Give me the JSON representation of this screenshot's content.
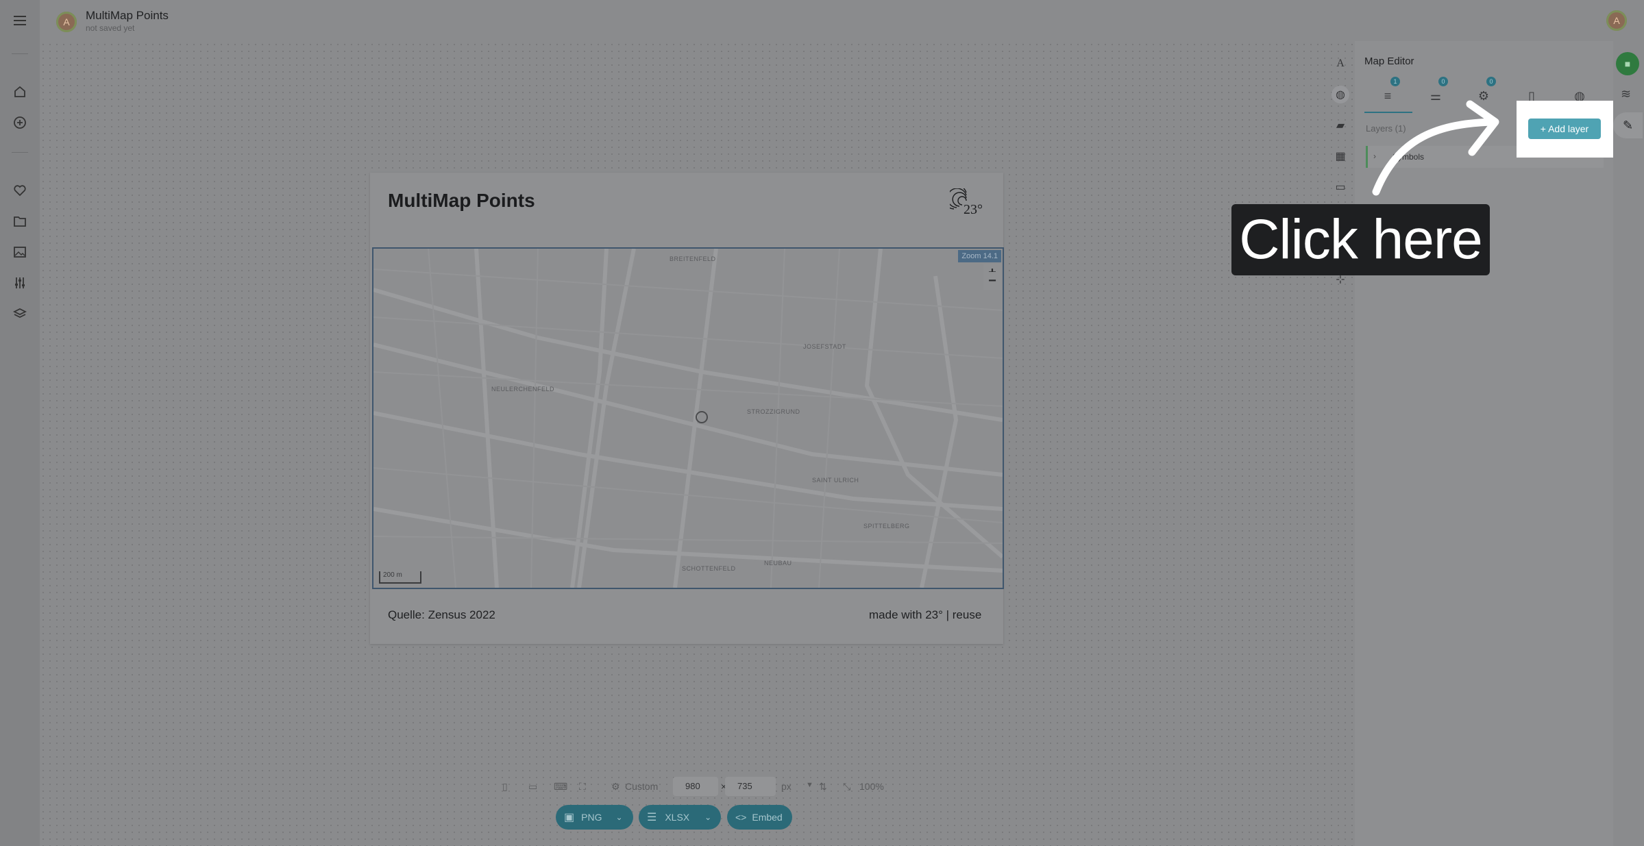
{
  "app": {
    "title": "MultiMap Points",
    "subtitle": "not saved yet",
    "avatar_initial": "A"
  },
  "left_nav": {
    "items": [
      "menu-icon",
      "home-icon",
      "add-icon",
      "heart-icon",
      "folder-icon",
      "image-icon",
      "sliders-icon",
      "layers-icon"
    ]
  },
  "card": {
    "title": "MultiMap Points",
    "logo_text": "23°",
    "source": "Quelle: Zensus 2022",
    "brand": "made with 23° | reuse"
  },
  "map": {
    "zoom_label": "Zoom 14.1",
    "zoom_in": "+",
    "zoom_out": "−",
    "scale_label": "200 m",
    "districts": [
      "BREITENFELD",
      "JOSEFSTADT",
      "NEULERCHENFELD",
      "STROZZIGRUND",
      "SAINT ULRICH",
      "SPITTELBERG",
      "SCHOTTENFELD",
      "NEUBAU"
    ]
  },
  "toolbar": {
    "preset_label": "Custom",
    "width_value": "980",
    "times": "×",
    "height_value": "735",
    "unit": "px",
    "zoom_level": "100%",
    "export_png": "PNG",
    "export_xlsx": "XLSX",
    "embed": "Embed"
  },
  "panel": {
    "title": "Map Editor",
    "tabs": [
      {
        "name": "layers",
        "badge": "1"
      },
      {
        "name": "filters",
        "badge": "0"
      },
      {
        "name": "settings",
        "badge": "0"
      },
      {
        "name": "map",
        "badge": ""
      },
      {
        "name": "globe",
        "badge": ""
      }
    ],
    "layers_label": "Layers (1)",
    "add_layer_label": "+ Add layer",
    "layer_name": "Symbols"
  },
  "callout": {
    "text": "Click here"
  },
  "colors": {
    "accent": "#4fa3b3",
    "save_green": "#2f7a3f",
    "pill_teal": "#2b6a78"
  }
}
